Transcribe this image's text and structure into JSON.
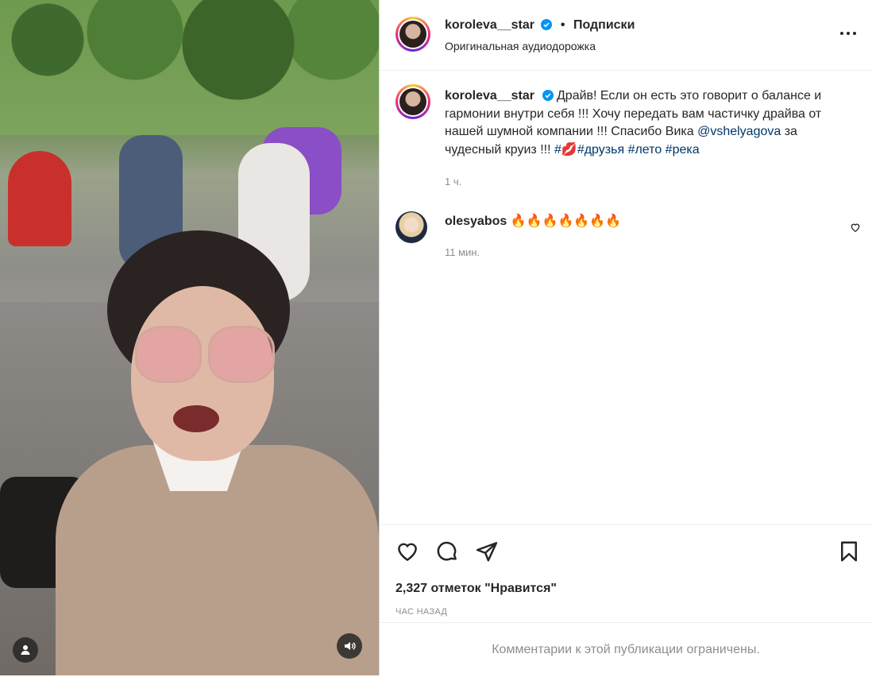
{
  "post": {
    "username": "koroleva__star",
    "follow_separator": "•",
    "follow_label": "Подписки",
    "audio": "Оригинальная аудиодорожка",
    "caption_text": "Драйв! Если он есть это говорит о балансе и гармонии внутри себя !!! Хочу передать вам частичку драйва от нашей шумной компании !!! Спасибо Вика ",
    "caption_mention": "@vshelyagova",
    "caption_after": " за чудесный круиз !!! ",
    "caption_tags": [
      "#💋",
      "#друзья",
      "#лето",
      "#река"
    ],
    "caption_time": "1 ч."
  },
  "comment": {
    "username": "olesyabos",
    "text": "🔥🔥🔥🔥🔥🔥🔥",
    "time": "11 мин."
  },
  "footer": {
    "likes": "2,327 отметок \"Нравится\"",
    "posted_ago": "ЧАС НАЗАД",
    "comments_limited": "Комментарии к этой публикации ограничены."
  },
  "icons": {
    "verified": "verified-badge-icon",
    "more": "more-options-icon",
    "comment_like": "heart-outline-icon",
    "like": "heart-icon",
    "comment": "comment-bubble-icon",
    "share": "paper-plane-icon",
    "save": "bookmark-icon",
    "user_tags": "user-tags-icon",
    "audio": "speaker-icon"
  },
  "colors": {
    "verified": "#0095f6",
    "link": "#00376b",
    "muted": "#8e8e8e"
  }
}
